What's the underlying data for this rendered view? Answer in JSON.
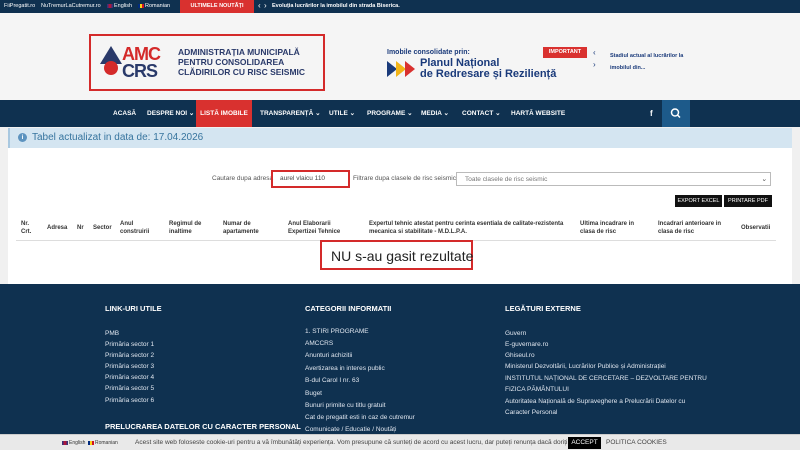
{
  "topbar": {
    "link1": "FiiPregatit.ro",
    "link2": "NuTremurLaCutremur.ro",
    "lang_en": "English",
    "lang_ro": "Romanian",
    "news_label": "ULTIMELE NOUTĂȚI",
    "news_text": "Evoluția lucrărilor la imobilul din strada Biserica.",
    "prev_glyph": "‹",
    "next_glyph": "›"
  },
  "header": {
    "logo_amc": "AMC",
    "logo_crs": "CRS",
    "logo_line1": "ADMINISTRAȚIA MUNICIPALĂ",
    "logo_line2": "PENTRU CONSOLIDAREA",
    "logo_line3": "CLĂDIRILOR CU RISC SEISMIC",
    "pnrr_intro": "Imobile consolidate prin:",
    "pnrr_line1": "Planul Național",
    "pnrr_line2": "de Redresare și Reziliență",
    "important_label": "IMPORTANT",
    "important_text": "Stadiul actual al lucrărilor la imobilul din...",
    "arrow_up": "‹",
    "arrow_down": "›"
  },
  "nav": {
    "items": [
      "ACASĂ",
      "DESPRE NOI ⌄",
      "LISTĂ IMOBILE",
      "TRANSPARENȚĂ ⌄",
      "UTILE ⌄",
      "PROGRAME ⌄",
      "MEDIA ⌄",
      "CONTACT ⌄",
      "HARTĂ WEBSITE"
    ],
    "facebook": "f"
  },
  "banner": {
    "text": "Tabel actualizat in data de: 17.04.2026",
    "icon": "info-icon"
  },
  "search": {
    "address_label": "Cautare dupa adresa",
    "address_value": "aurel vlaicu 110",
    "filter_label": "Filtrare dupa clasele de risc seismic",
    "filter_selected": "Toate clasele de risc seismic"
  },
  "buttons": {
    "export_excel": "EXPORT EXCEL",
    "print_pdf": "PRINTARE PDF"
  },
  "table": {
    "headers": [
      "Nr. Crt.",
      "Adresa",
      "Nr",
      "Sector",
      "Anul construirii",
      "Regimul de inaltime",
      "Numar de apartamente",
      "Anul Elaborarii Expertizei Tehnice",
      "Expertul tehnic atestat pentru cerinta esentiala de calitate-rezistenta mecanica si stabilitate - M.D.L.P.A.",
      "Ultima incadrare in clasa de risc",
      "Incadrari anterioare in clasa de risc",
      "Observatii"
    ],
    "no_results": "NU s-au gasit rezultate"
  },
  "footer": {
    "col1": {
      "title": "LINK-URI UTILE",
      "links": [
        "PMB",
        "Primăria sector 1",
        "Primăria sector 2",
        "Primăria sector 3",
        "Primăria sector 4",
        "Primăria sector 5",
        "Primăria sector 6"
      ],
      "title2": "PRELUCRAREA DATELOR CU CARACTER PERSONAL"
    },
    "col2": {
      "title": "CATEGORII INFORMATII",
      "links": [
        "1. STIRI PROGRAME",
        "AMCCRS",
        "Anunturi achizitii",
        "Avertizarea in interes public",
        "B-dul Carol I nr. 63",
        "Buget",
        "Bunuri primite cu titlu gratuit",
        "Cat de pregatit esti in caz de cutremur",
        "Comunicate / Educatie / Noutăți"
      ]
    },
    "col3": {
      "title": "LEGĂTURI EXTERNE",
      "links": [
        "Guvern",
        "E-guvernare.ro",
        "Ghiseul.ro",
        "Ministerul Dezvoltării, Lucrărilor Publice și Administrației",
        "INSTITUTUL NAȚIONAL DE CERCETARE – DEZVOLTARE PENTRU",
        "FIZICA PĂMÂNTULUI",
        "Autoritatea Națională de Supraveghere a Prelucrării Datelor cu",
        "Caracter Personal"
      ]
    }
  },
  "cookie": {
    "lang_en": "English",
    "lang_ro": "Romanian",
    "text": "Acest site web foloseste cookie-uri pentru a vă îmbunătăți experiența. Vom presupune că sunteți de acord cu acest lucru, dar puteți renunța dacă doriți.",
    "accept": "ACCEPT",
    "policy": "POLITICA COOKIES"
  },
  "colors": {
    "navy": "#0f3150",
    "red": "#d9312f",
    "banner": "#d4e5f1"
  }
}
